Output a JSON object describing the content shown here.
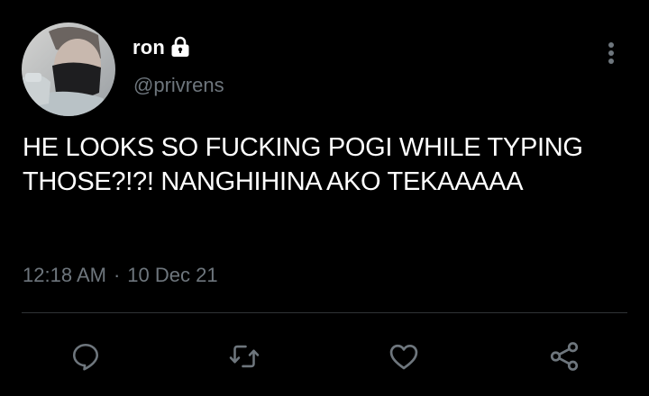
{
  "tweet": {
    "display_name": "ron",
    "handle": "@privrens",
    "text": "HE LOOKS SO FUCKING POGI WHILE TYPING THOSE?!?! NANGHIHINA AKO TEKAAAAA",
    "time": "12:18 AM",
    "separator": "·",
    "date": "10 Dec 21",
    "protected": true
  },
  "icons": {
    "avatar": "profile-photo",
    "lock": "lock-icon",
    "more": "more-vertical-icon",
    "reply": "reply-icon",
    "retweet": "retweet-icon",
    "like": "heart-icon",
    "share": "share-icon"
  },
  "colors": {
    "background": "#000000",
    "text_primary": "#ffffff",
    "text_secondary": "#6e767d",
    "divider": "#2f3336",
    "icon": "#6e767d"
  }
}
